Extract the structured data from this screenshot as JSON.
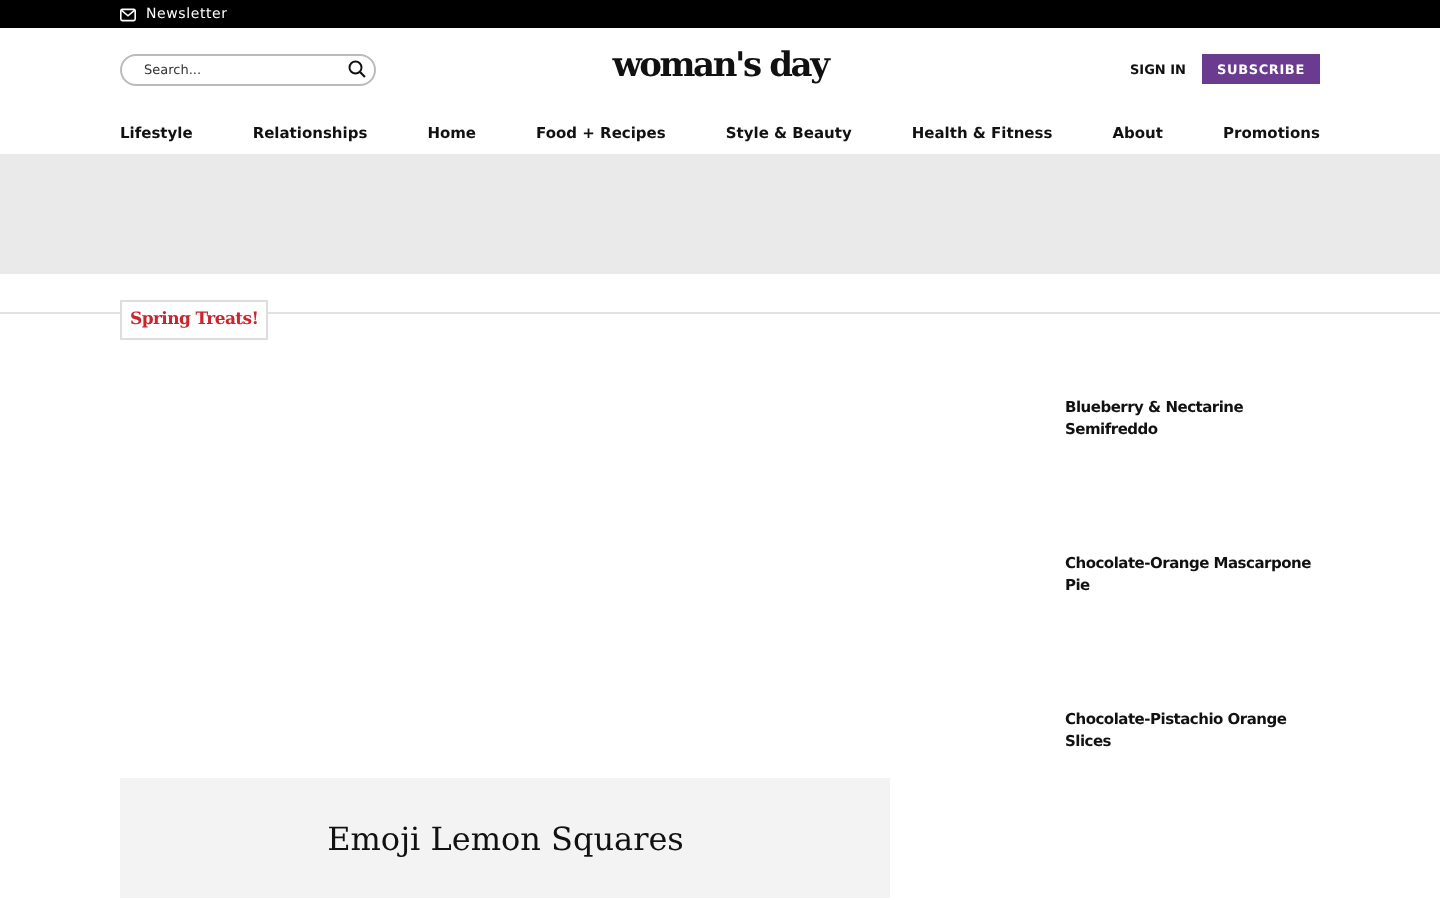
{
  "top_bar": {
    "newsletter": "Newsletter"
  },
  "header": {
    "search": {
      "placeholder": "Search..."
    },
    "logo": "woman's day",
    "sign_in": "SIGN IN",
    "subscribe": "SUBSCRIBE"
  },
  "nav": [
    "Lifestyle",
    "Relationships",
    "Home",
    "Food + Recipes",
    "Style & Beauty",
    "Health & Fitness",
    "About",
    "Promotions"
  ],
  "section_label": "Spring Treats!",
  "feature": {
    "title": "Emoji Lemon Squares"
  },
  "sidebar": [
    {
      "title": "Blueberry & Nectarine Semifreddo"
    },
    {
      "title": "Chocolate-Orange Mascarpone Pie"
    },
    {
      "title": "Chocolate-Pistachio Orange Slices"
    }
  ]
}
